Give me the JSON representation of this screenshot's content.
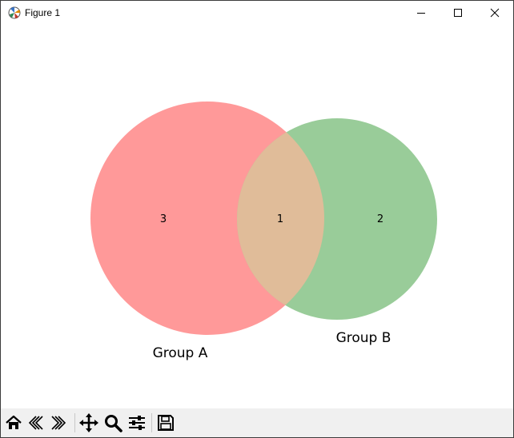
{
  "window": {
    "title": "Figure 1",
    "icons": {
      "app": "matplotlib-icon",
      "minimize": "minimize-icon",
      "maximize": "maximize-icon",
      "close": "close-icon"
    }
  },
  "chart_data": {
    "type": "venn",
    "sets": [
      {
        "label": "Group A",
        "color": "#ff9999"
      },
      {
        "label": "Group B",
        "color": "#99cc99"
      }
    ],
    "regions": {
      "A_only": "3",
      "intersection": "1",
      "B_only": "2"
    },
    "intersection_color": "#e0bc99"
  },
  "toolbar": {
    "tools": [
      {
        "name": "home-icon"
      },
      {
        "name": "back-icon"
      },
      {
        "name": "forward-icon"
      },
      {
        "name": "pan-icon"
      },
      {
        "name": "zoom-icon"
      },
      {
        "name": "configure-subplots-icon"
      },
      {
        "name": "save-icon"
      }
    ]
  }
}
